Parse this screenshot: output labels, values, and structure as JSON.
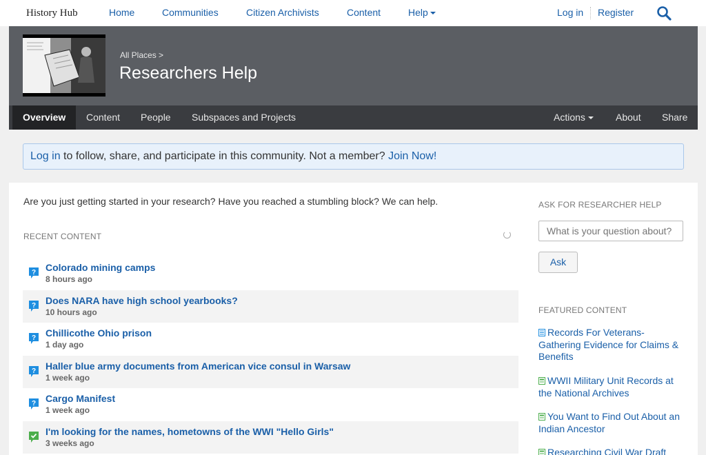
{
  "topnav": {
    "brand": "History Hub",
    "links": [
      "Home",
      "Communities",
      "Citizen Archivists",
      "Content",
      "Help"
    ],
    "login": "Log in",
    "register": "Register"
  },
  "header": {
    "breadcrumb": "All Places >",
    "title": "Researchers Help"
  },
  "subnav": {
    "tabs": [
      "Overview",
      "Content",
      "People",
      "Subspaces and Projects"
    ],
    "actions": "Actions",
    "about": "About",
    "share": "Share"
  },
  "login_banner": {
    "login": "Log in",
    "text": " to follow, share, and participate in this community. Not a member? ",
    "join": "Join Now!"
  },
  "main": {
    "intro": "Are you just getting started in your research? Have you reached a stumbling block? We can help.",
    "recent_heading": "RECENT CONTENT",
    "items": [
      {
        "title": "Colorado mining camps",
        "time": "8 hours ago",
        "icon": "question-icon"
      },
      {
        "title": "Does NARA have high school yearbooks?",
        "time": "10 hours ago",
        "icon": "question-icon"
      },
      {
        "title": "Chillicothe Ohio prison",
        "time": "1 day ago",
        "icon": "question-icon"
      },
      {
        "title": "Haller blue army documents from American vice consul in Warsaw",
        "time": "1 week ago",
        "icon": "question-icon"
      },
      {
        "title": "Cargo Manifest",
        "time": "1 week ago",
        "icon": "question-icon"
      },
      {
        "title": "I'm looking for the names, hometowns of the WWI \"Hello Girls\"",
        "time": "3 weeks ago",
        "icon": "answered-icon"
      }
    ]
  },
  "sidebar": {
    "ask_heading": "ASK FOR RESEARCHER HELP",
    "ask_placeholder": "What is your question about?",
    "ask_button": "Ask",
    "featured_heading": "FEATURED CONTENT",
    "featured": [
      "Records For Veterans-Gathering Evidence for Claims & Benefits",
      "WWII Military Unit Records at the National Archives",
      "You Want to Find Out About an Indian Ancestor",
      "Researching Civil War Draft"
    ]
  },
  "colors": {
    "link": "#1a5fa8",
    "question_icon": "#1e8ee0",
    "answered_icon": "#4cae4c",
    "banner": "#5b5e63",
    "subnav": "#3a3c40"
  }
}
